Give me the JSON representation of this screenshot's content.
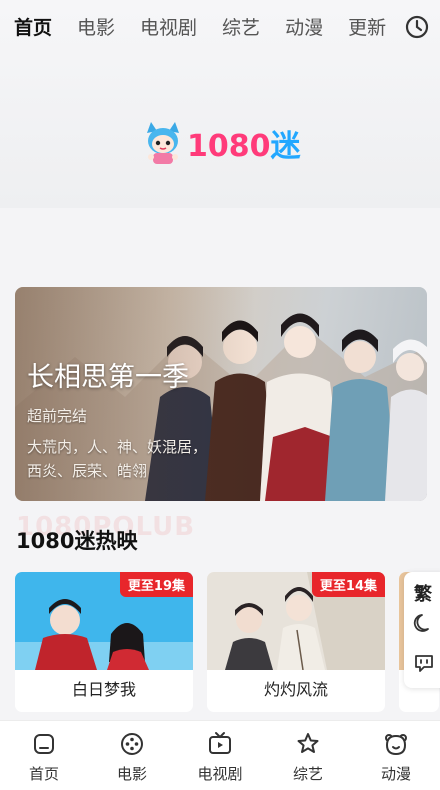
{
  "topnav": {
    "tabs": [
      {
        "label": "首页",
        "active": true
      },
      {
        "label": "电影"
      },
      {
        "label": "电视剧"
      },
      {
        "label": "综艺"
      },
      {
        "label": "动漫"
      },
      {
        "label": "更新"
      }
    ],
    "history_icon": "clock-icon"
  },
  "logo": {
    "number": "1080",
    "cn": "迷",
    "mascot": "mascot-icon"
  },
  "banner": {
    "title": "长相思第一季",
    "status": "超前完结",
    "desc": "大荒内，人、神、妖混居，西炎、辰荣、皓翎"
  },
  "section": {
    "watermark": "1080POLUB",
    "title": "1080迷热映"
  },
  "cards": [
    {
      "name": "白日梦我",
      "badge": "更至19集"
    },
    {
      "name": "灼灼风流",
      "badge": "更至14集"
    }
  ],
  "float_panel": {
    "traditional": "繁",
    "icons": [
      "moon-icon",
      "message-icon"
    ]
  },
  "bottomnav": [
    {
      "label": "首页",
      "icon": "home-icon"
    },
    {
      "label": "电影",
      "icon": "film-reel-icon"
    },
    {
      "label": "电视剧",
      "icon": "tv-icon"
    },
    {
      "label": "综艺",
      "icon": "star-icon"
    },
    {
      "label": "动漫",
      "icon": "bear-icon"
    }
  ],
  "colors": {
    "badge": "#e8262b",
    "logo_number": "#ff3b7a",
    "logo_cn": "#22a7ff",
    "tab_highlight": "#ffc43c"
  }
}
